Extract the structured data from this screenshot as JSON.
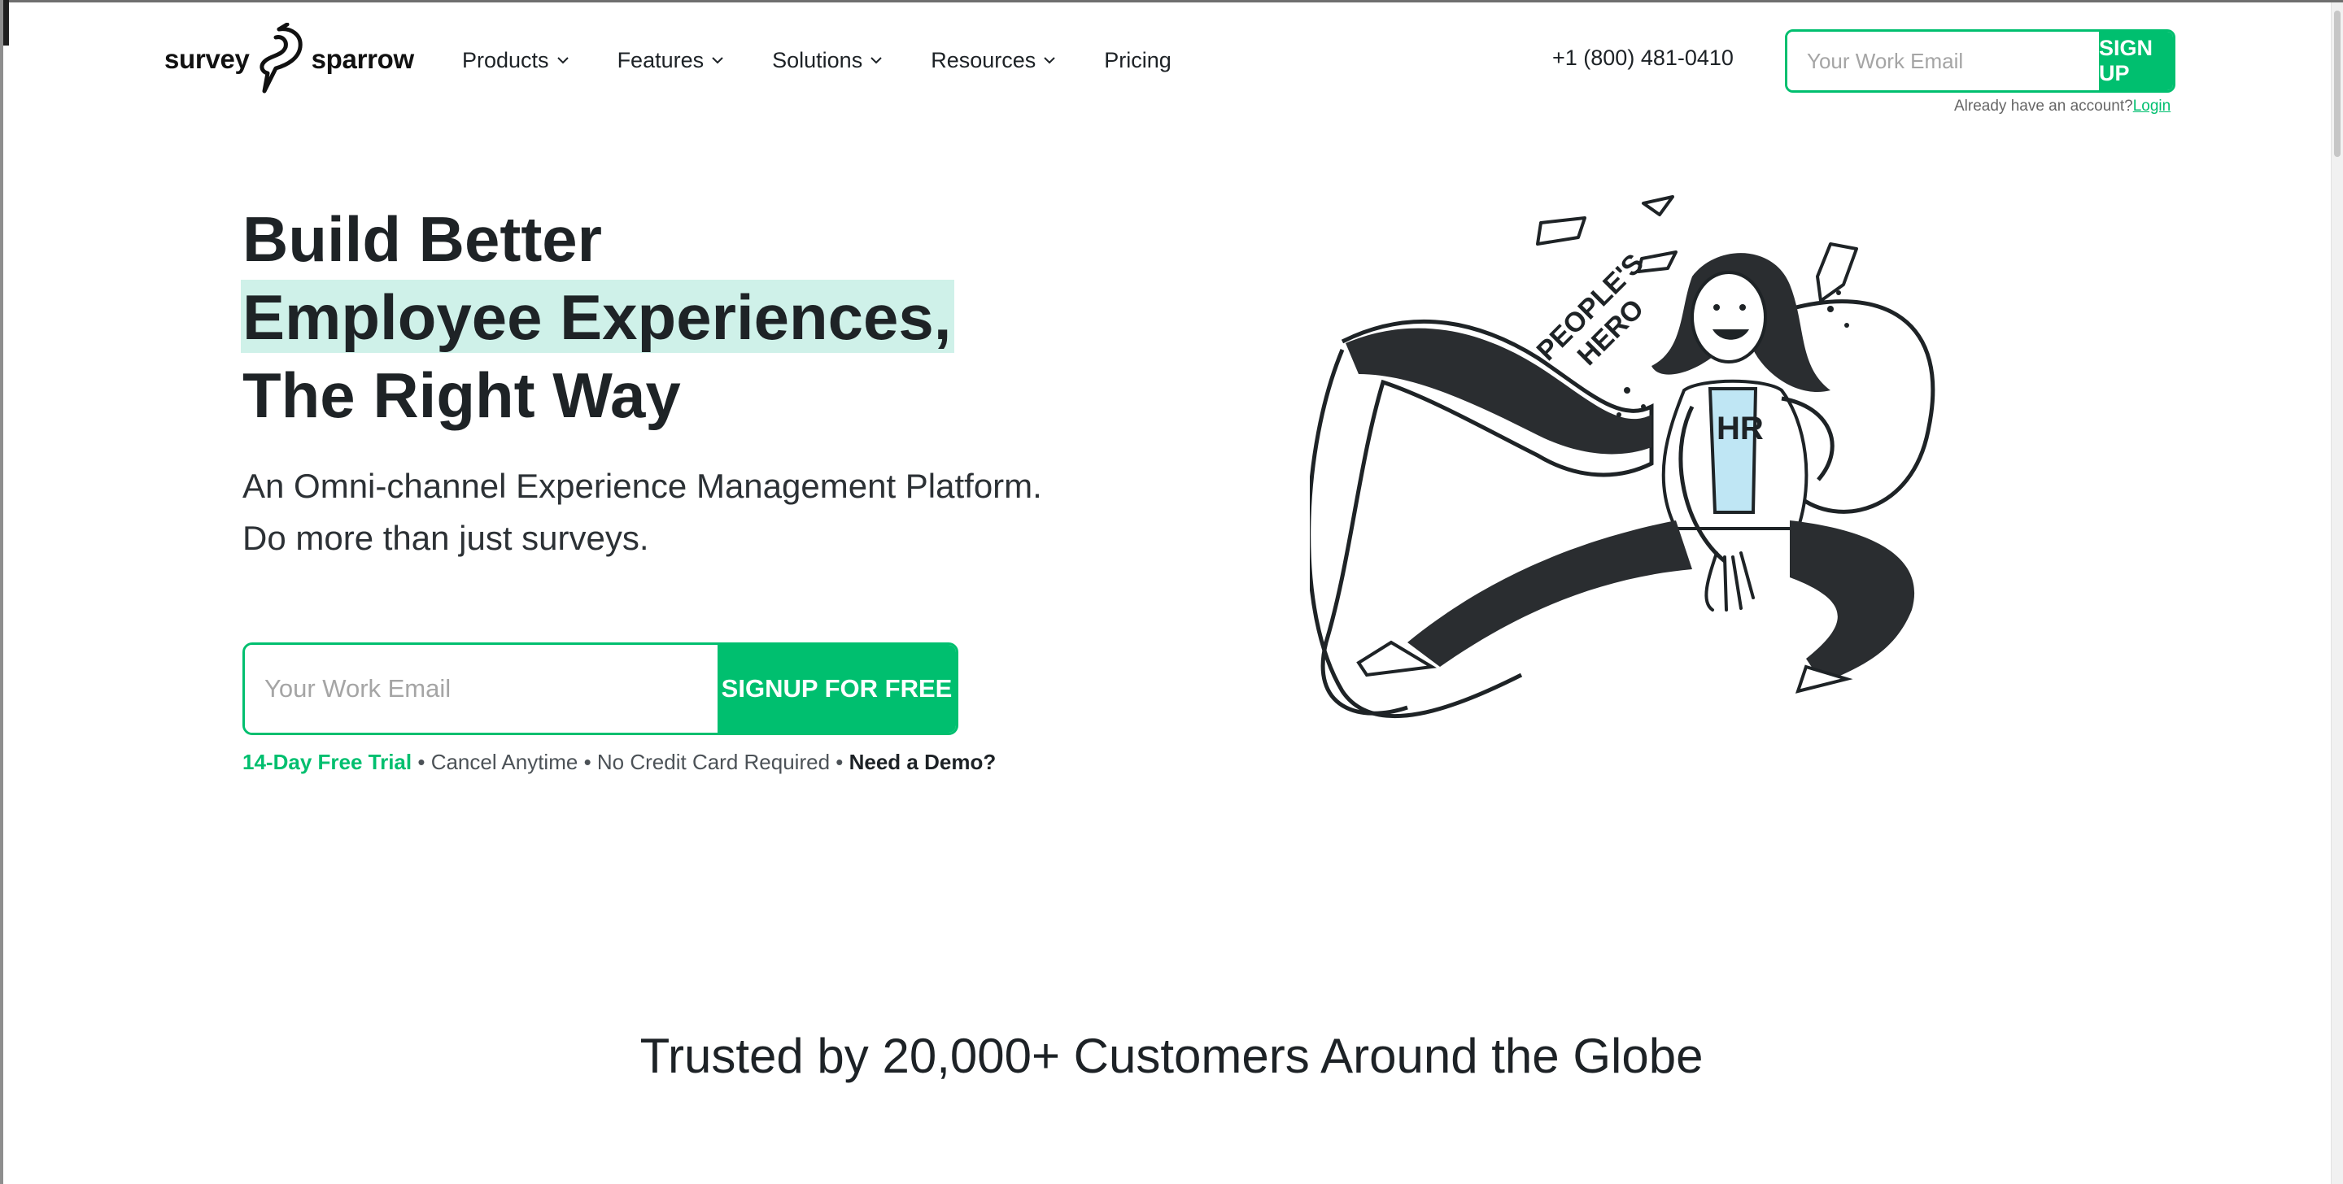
{
  "brand": {
    "logo_left": "survey",
    "logo_right": "sparrow",
    "accent_color": "#00bf6f",
    "highlight_color": "#cff1e9"
  },
  "nav": {
    "items": [
      {
        "label": "Products",
        "has_dropdown": true
      },
      {
        "label": "Features",
        "has_dropdown": true
      },
      {
        "label": "Solutions",
        "has_dropdown": true
      },
      {
        "label": "Resources",
        "has_dropdown": true
      },
      {
        "label": "Pricing",
        "has_dropdown": false
      }
    ],
    "phone": "+1 (800) 481-0410",
    "signup_placeholder": "Your Work Email",
    "signup_label": "SIGN UP",
    "login_prompt": "Already have an account?",
    "login_label": "Login"
  },
  "hero": {
    "title_line1": "Build Better",
    "title_line2": "Employee Experiences,",
    "title_line3": "The Right Way",
    "subtitle_line1": "An Omni-channel Experience Management Platform.",
    "subtitle_line2": "Do more than just surveys.",
    "email_placeholder": "Your Work Email",
    "cta_label": "SIGNUP FOR FREE",
    "trial_label": "14-Day Free Trial",
    "sep": " • ",
    "cancel_label": "Cancel Anytime",
    "no_card_label": "No Credit Card Required",
    "demo_label": "Need a Demo?"
  },
  "illustration": {
    "banner_text_1": "PEOPLE'S",
    "banner_text_2": "HERO",
    "shirt_text": "HR"
  },
  "trusted": {
    "heading": "Trusted by 20,000+ Customers Around the Globe"
  }
}
